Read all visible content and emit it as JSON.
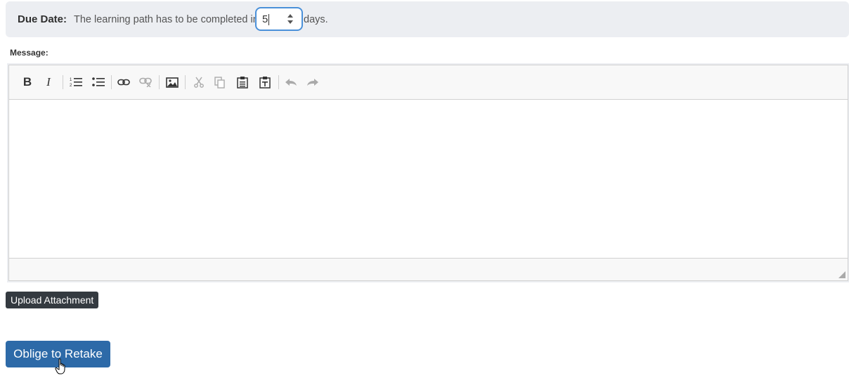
{
  "due_date": {
    "label": "Due Date:",
    "text_before": "The learning path has to be completed in",
    "value": "5",
    "text_after": "days."
  },
  "message": {
    "label": "Message:",
    "toolbar_icons": [
      "bold-icon",
      "italic-icon",
      "numbered-list-icon",
      "bulleted-list-icon",
      "link-icon",
      "unlink-icon",
      "image-icon",
      "cut-icon",
      "copy-icon",
      "paste-icon",
      "paste-text-icon",
      "undo-icon",
      "redo-icon"
    ],
    "bold_glyph": "B",
    "italic_glyph": "I"
  },
  "buttons": {
    "upload_label": "Upload Attachment",
    "retake_label": "Oblige to Retake"
  },
  "colors": {
    "primary": "#2d6aa8",
    "dark": "#343a40",
    "focus": "#4a90d9"
  }
}
